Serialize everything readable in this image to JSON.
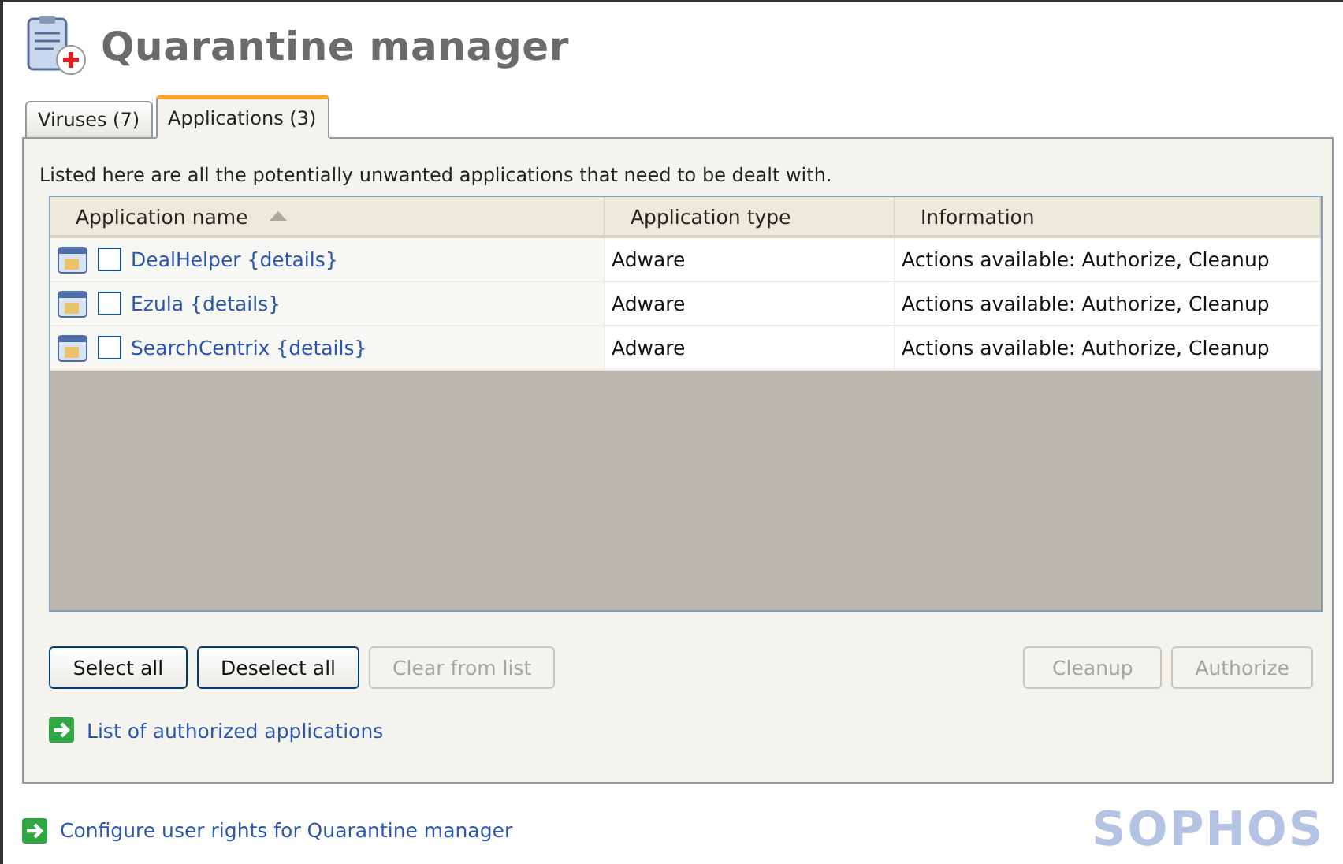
{
  "title": "Quarantine manager",
  "tabs": [
    {
      "label": "Viruses (7)",
      "selected": false
    },
    {
      "label": "Applications (3)",
      "selected": true
    }
  ],
  "description": "Listed here are all the potentially unwanted applications that need to be dealt with.",
  "table": {
    "columns": [
      {
        "label": "Application name",
        "sorted": true
      },
      {
        "label": "Application type",
        "sorted": false
      },
      {
        "label": "Information",
        "sorted": false
      }
    ],
    "rows": [
      {
        "name": "DealHelper {details}",
        "checked": false,
        "type": "Adware",
        "information": "Actions available: Authorize, Cleanup"
      },
      {
        "name": "Ezula {details}",
        "checked": false,
        "type": "Adware",
        "information": "Actions available: Authorize, Cleanup"
      },
      {
        "name": "SearchCentrix {details}",
        "checked": false,
        "type": "Adware",
        "information": "Actions available: Authorize, Cleanup"
      }
    ]
  },
  "left_buttons": [
    {
      "label": "Select all",
      "disabled": false
    },
    {
      "label": "Deselect all",
      "disabled": false
    },
    {
      "label": "Clear from list",
      "disabled": true
    }
  ],
  "right_buttons": [
    {
      "label": "Cleanup",
      "disabled": true
    },
    {
      "label": "Authorize",
      "disabled": true
    }
  ],
  "panel_link": "List of authorized applications",
  "footer_link": "Configure user rights for Quarantine manager",
  "brand": "SOPHOS"
}
